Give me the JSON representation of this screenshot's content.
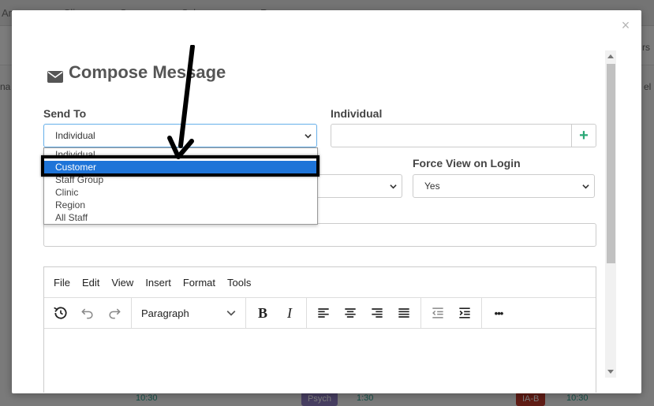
{
  "background": {
    "topbar_fragments": [
      "An",
      "Clie",
      "Sc",
      "Sch",
      "Ro"
    ],
    "right_fragment_1": "rs",
    "right_fragment_2": "el",
    "left_fragment": "na",
    "times": [
      "10:30",
      "1:30",
      "10:30"
    ],
    "pills": [
      "Psych",
      "IA-B"
    ]
  },
  "modal": {
    "close_label": "×",
    "title": "Compose Message",
    "send_to": {
      "label": "Send To",
      "selected": "Individual",
      "options": [
        "Individual",
        "Customer",
        "Staff Group",
        "Clinic",
        "Region",
        "All Staff"
      ],
      "highlighted_index": 1
    },
    "individual": {
      "label": "Individual",
      "value": "",
      "add_label": "+"
    },
    "force_view": {
      "label": "Force View on Login",
      "selected": "Yes"
    },
    "second_select_value": ""
  },
  "editor": {
    "menu": [
      "File",
      "Edit",
      "View",
      "Insert",
      "Format",
      "Tools"
    ],
    "block_format": "Paragraph",
    "bold_label": "B",
    "italic_label": "I",
    "more_label": "•••"
  },
  "colors": {
    "accent": "#1e74d8",
    "add_green": "#2aa876",
    "title_gray": "#555555"
  }
}
